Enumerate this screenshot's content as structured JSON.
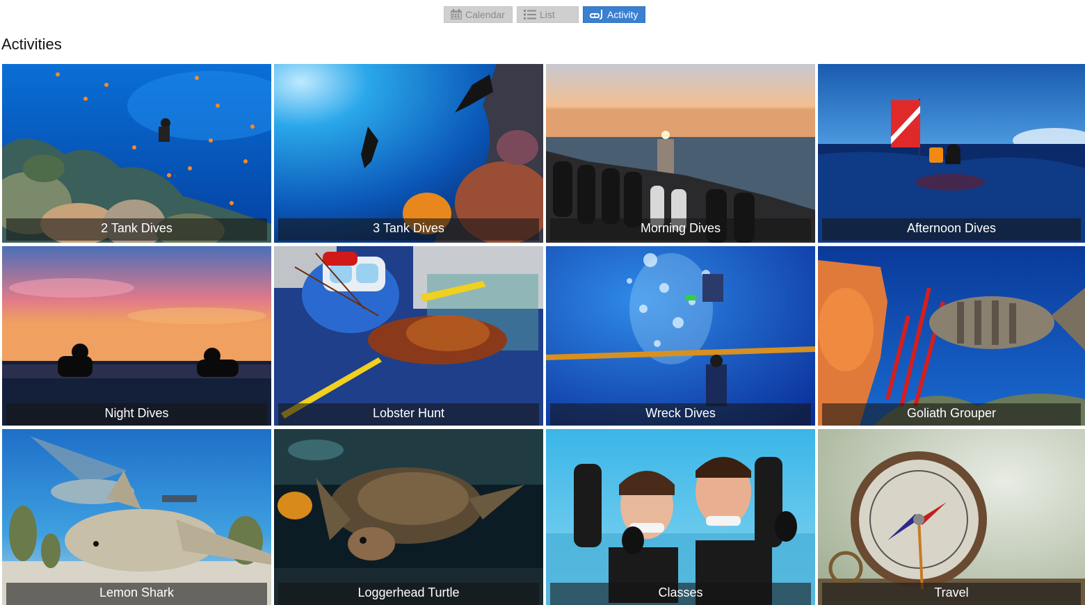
{
  "view_switch": {
    "calendar_label": "Calendar",
    "list_label": "List",
    "activity_label": "Activity",
    "active": "Activity"
  },
  "page": {
    "title": "Activities"
  },
  "activities": [
    {
      "label": "2 Tank Dives",
      "image": "coral-reef-diver"
    },
    {
      "label": "3 Tank Dives",
      "image": "wall-divers"
    },
    {
      "label": "Morning Dives",
      "image": "sunrise-boat-tanks"
    },
    {
      "label": "Afternoon Dives",
      "image": "diver-flag-ocean"
    },
    {
      "label": "Night Dives",
      "image": "sunset-divers"
    },
    {
      "label": "Lobster Hunt",
      "image": "lobster-mask-net"
    },
    {
      "label": "Wreck Dives",
      "image": "bubbles-rope-diver"
    },
    {
      "label": "Goliath Grouper",
      "image": "grouper-reef"
    },
    {
      "label": "Lemon Shark",
      "image": "lemon-shark"
    },
    {
      "label": "Loggerhead Turtle",
      "image": "sea-turtle"
    },
    {
      "label": "Classes",
      "image": "divers-couple"
    },
    {
      "label": "Travel",
      "image": "compass"
    }
  ],
  "colors": {
    "active_button": "#3a7fd0",
    "inactive_button": "#cfcfcf",
    "caption_bg": "rgba(20,20,20,0.58)"
  }
}
